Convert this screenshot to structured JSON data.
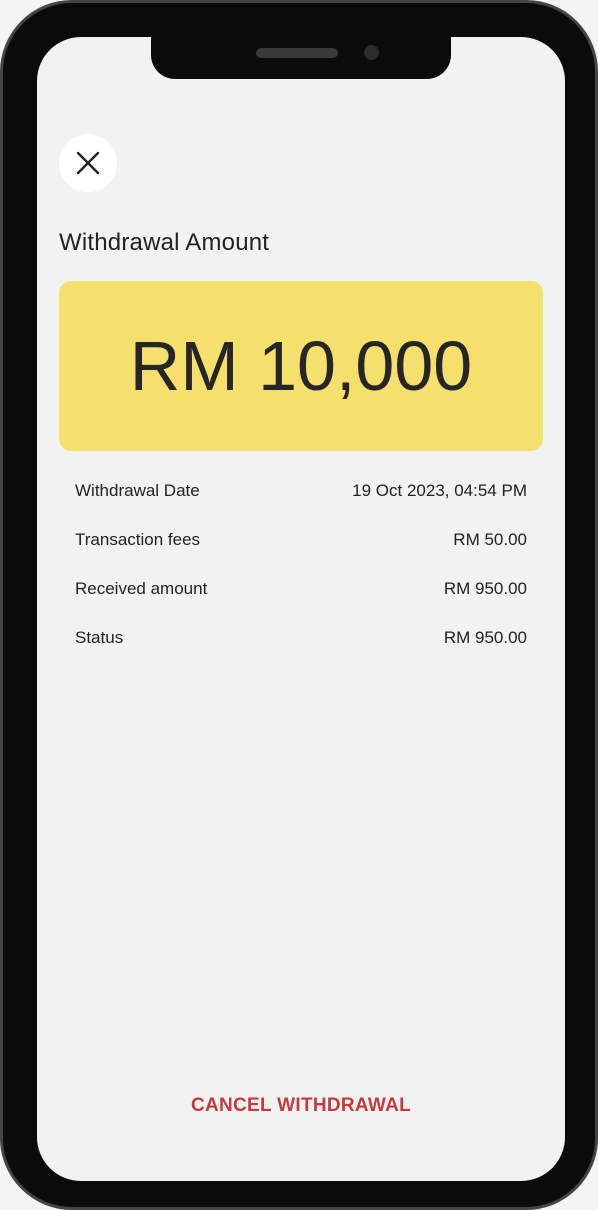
{
  "header": {
    "close_icon": "close-icon"
  },
  "withdrawal": {
    "title": "Withdrawal Amount",
    "amount": "RM 10,000",
    "card_color": "#f5e06e"
  },
  "details": [
    {
      "label": "Withdrawal Date",
      "value": "19 Oct 2023, 04:54 PM"
    },
    {
      "label": "Transaction fees",
      "value": "RM 50.00"
    },
    {
      "label": "Received amount",
      "value": "RM 950.00"
    },
    {
      "label": "Status",
      "value": "RM 950.00"
    }
  ],
  "actions": {
    "cancel_label": "CANCEL WITHDRAWAL",
    "cancel_color": "#c63a3f"
  }
}
